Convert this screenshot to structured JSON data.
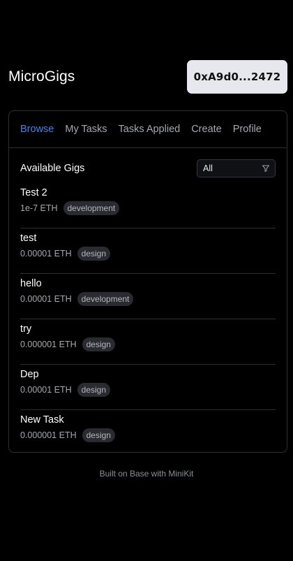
{
  "app": {
    "title": "MicroGigs",
    "wallet_address": "0xA9d0...2472"
  },
  "tabs": [
    {
      "label": "Browse",
      "active": true
    },
    {
      "label": "My Tasks",
      "active": false
    },
    {
      "label": "Tasks Applied",
      "active": false
    },
    {
      "label": "Create",
      "active": false
    },
    {
      "label": "Profile",
      "active": false
    }
  ],
  "browse": {
    "heading": "Available Gigs",
    "filter": {
      "selected": "All",
      "icon": "filter-icon"
    },
    "gigs": [
      {
        "title": "Test 2",
        "price": "1e-7 ETH",
        "category": "development"
      },
      {
        "title": "test",
        "price": "0.00001 ETH",
        "category": "design"
      },
      {
        "title": "hello",
        "price": "0.00001 ETH",
        "category": "development"
      },
      {
        "title": "try",
        "price": "0.000001 ETH",
        "category": "design"
      },
      {
        "title": "Dep",
        "price": "0.00001 ETH",
        "category": "design"
      },
      {
        "title": "New Task",
        "price": "0.000001 ETH",
        "category": "design"
      }
    ]
  },
  "footer": {
    "text": "Built on Base with MiniKit"
  },
  "colors": {
    "background": "#000000",
    "accent": "#4e7ff0",
    "wallet_button": "#e6e8ee",
    "border": "#2e2e33"
  }
}
